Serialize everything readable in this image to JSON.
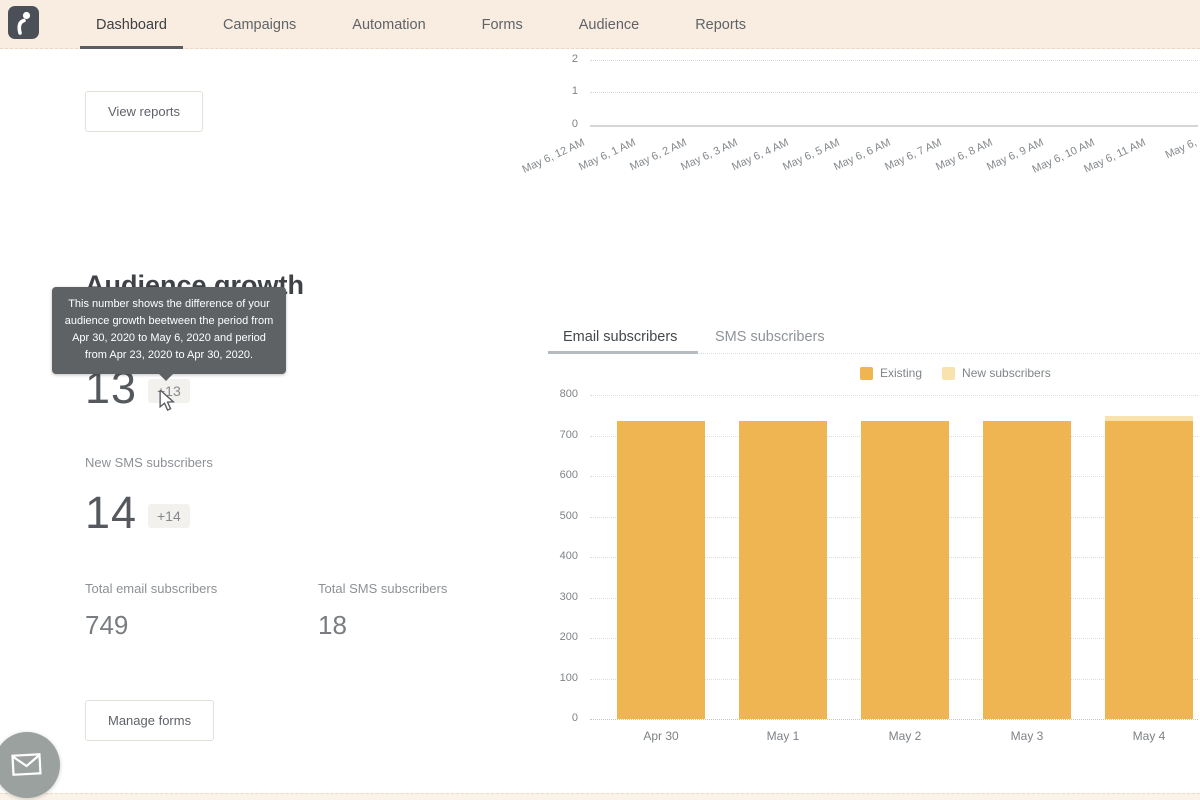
{
  "nav": {
    "logo_name": "omnisend-logo",
    "tabs": [
      {
        "label": "Dashboard",
        "active": true
      },
      {
        "label": "Campaigns",
        "active": false
      },
      {
        "label": "Automation",
        "active": false
      },
      {
        "label": "Forms",
        "active": false
      },
      {
        "label": "Audience",
        "active": false
      },
      {
        "label": "Reports",
        "active": false
      }
    ]
  },
  "left": {
    "view_reports_button": "View reports",
    "section_title": "Audience growth",
    "tooltip_text": "This number shows the difference of your audience growth beetween the period from Apr 30, 2020 to May 6, 2020 and period from Apr 23, 2020 to Apr 30, 2020.",
    "new_email": {
      "value": "13",
      "delta": "+13"
    },
    "new_sms": {
      "label": "New SMS subscribers",
      "value": "14",
      "delta": "+14"
    },
    "totals": [
      {
        "label": "Total email subscribers",
        "value": "749"
      },
      {
        "label": "Total SMS subscribers",
        "value": "18"
      }
    ],
    "manage_forms_button": "Manage forms"
  },
  "right": {
    "tabs": [
      {
        "label": "Email subscribers",
        "active": true
      },
      {
        "label": "SMS subscribers",
        "active": false
      }
    ],
    "legend": [
      {
        "label": "Existing",
        "color": "#efb553",
        "style": "solid"
      },
      {
        "label": "New subscribers",
        "color": "#f8e3ae",
        "style": "dotted"
      }
    ]
  },
  "chart_data": [
    {
      "type": "line",
      "title": "",
      "x": [
        "May 6, 12 AM",
        "May 6, 1 AM",
        "May 6, 2 AM",
        "May 6, 3 AM",
        "May 6, 4 AM",
        "May 6, 5 AM",
        "May 6, 6 AM",
        "May 6, 7 AM",
        "May 6, 8 AM",
        "May 6, 9 AM",
        "May 6, 10 AM",
        "May 6, 11 AM",
        "May 6,"
      ],
      "yticks": [
        0,
        1,
        2
      ],
      "ylim": [
        0,
        2
      ],
      "series": [],
      "grid": "dotted-horizontal",
      "note_visible_data": "no data plotted above zero line"
    },
    {
      "type": "bar",
      "stacked": true,
      "categories": [
        "Apr 30",
        "May 1",
        "May 2",
        "May 3",
        "May 4"
      ],
      "series": [
        {
          "name": "Existing",
          "values": [
            735,
            735,
            735,
            735,
            735
          ],
          "color": "#efb553"
        },
        {
          "name": "New subscribers",
          "values": [
            0,
            0,
            0,
            0,
            14
          ],
          "color": "#f8e3ae"
        }
      ],
      "yticks": [
        0,
        100,
        200,
        300,
        400,
        500,
        600,
        700,
        800
      ],
      "ylim": [
        0,
        800
      ],
      "xlabel": "",
      "ylabel": "",
      "legend_position": "top-right"
    }
  ],
  "fab": {
    "icon": "envelope-icon"
  },
  "colors": {
    "nav_background": "#f9ede1",
    "accent_bar": "#efb553",
    "accent_bar_light": "#f8e3ae",
    "tooltip_background": "#5e6265",
    "text_dark": "#3f4347",
    "text_gray": "#8d9196"
  }
}
